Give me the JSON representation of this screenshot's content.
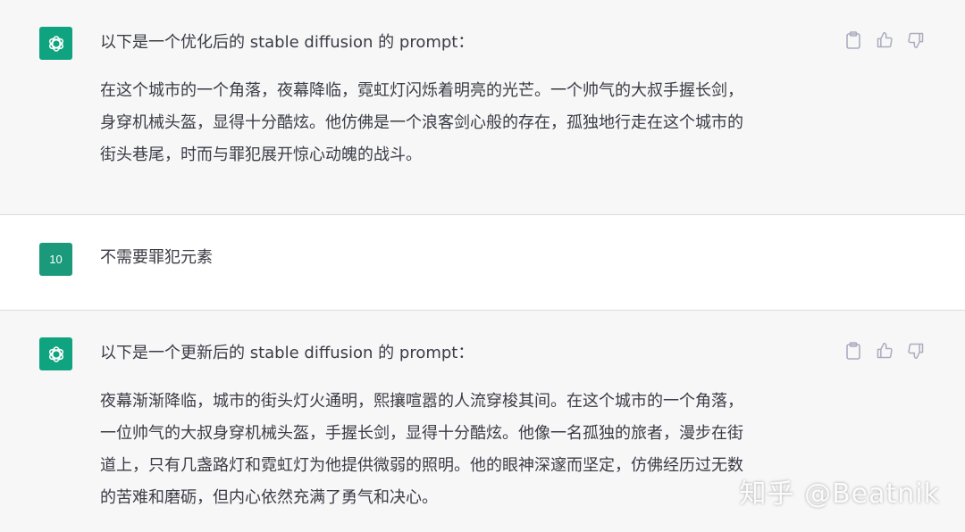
{
  "messages": [
    {
      "role": "assistant",
      "avatar_icon": "openai-logo-icon",
      "intro": "以下是一个优化后的 stable diffusion 的 prompt：",
      "body_lines": [
        "在这个城市的一个角落，夜幕降临，霓虹灯闪烁着明亮的光芒。一个帅气的大叔手握长剑，",
        "身穿机械头盔，显得十分酷炫。他仿佛是一个浪客剑心般的存在，孤独地行走在这个城市的",
        "街头巷尾，时而与罪犯展开惊心动魄的战斗。"
      ]
    },
    {
      "role": "user",
      "avatar_label": "10",
      "text": "不需要罪犯元素"
    },
    {
      "role": "assistant",
      "avatar_icon": "openai-logo-icon",
      "intro": "以下是一个更新后的 stable diffusion 的 prompt：",
      "body_lines": [
        "夜幕渐渐降临，城市的街头灯火通明，熙攘喧嚣的人流穿梭其间。在这个城市的一个角落，",
        "一位帅气的大叔身穿机械头盔，手握长剑，显得十分酷炫。他像一名孤独的旅者，漫步在街",
        "道上，只有几盏路灯和霓虹灯为他提供微弱的照明。他的眼神深邃而坚定，仿佛经历过无数",
        "的苦难和磨砺，但内心依然充满了勇气和决心。"
      ]
    }
  ],
  "actions": [
    "clipboard-icon",
    "thumbs-up-icon",
    "thumbs-down-icon"
  ],
  "watermark": "知乎 @Beatnik",
  "colors": {
    "assistant_bg": "#f7f7f8",
    "user_bg": "#ffffff",
    "avatar_gpt": "#10a37f",
    "avatar_user": "#1a9a7a",
    "text": "#3b3c45",
    "icon": "#acacbe"
  }
}
